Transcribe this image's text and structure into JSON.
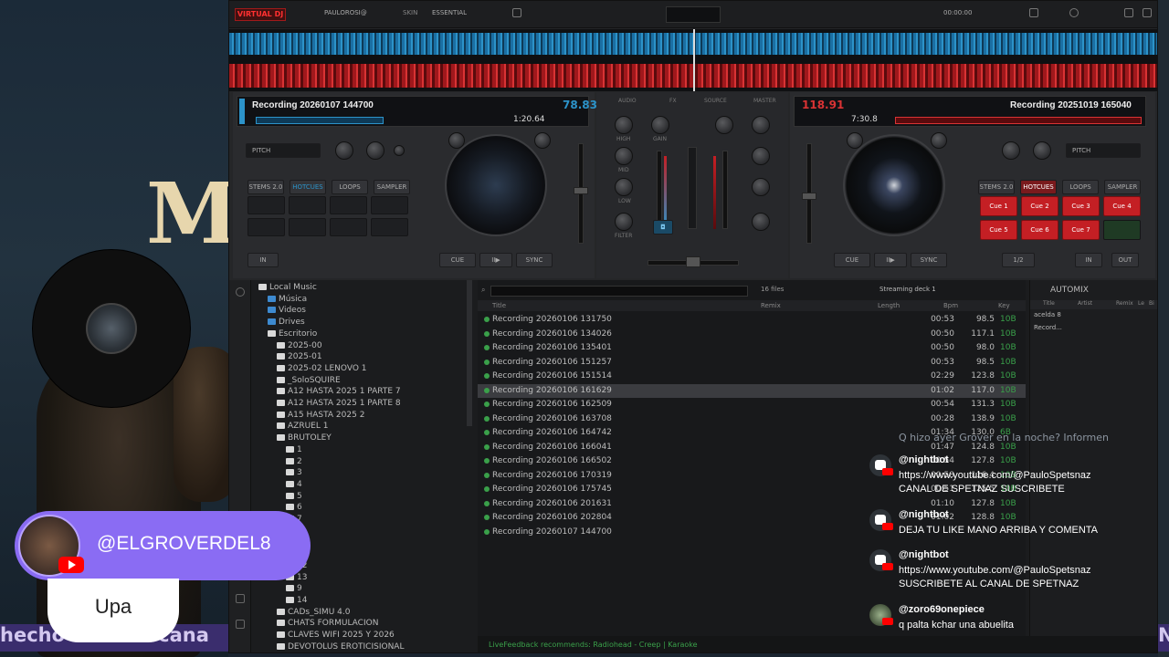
{
  "stream": {
    "bg_title": "M",
    "marquee_left": "hecho en este cana",
    "marquee_right": "N",
    "user_handle": "@ELGROVERDEL8",
    "user_message": "Upa"
  },
  "app": {
    "logo": "VIRTUAL DJ",
    "user": "PAULOROSI@",
    "skin_label": "SKIN",
    "skin_value": "ESSENTIAL",
    "clock": "00:00:00"
  },
  "deck_left": {
    "track": "Recording 20260107 144700",
    "bpm": "78.83",
    "elapsed": "1:20.64",
    "pitch_label": "PITCH",
    "tabs": [
      "STEMS 2.0",
      "HOTCUES",
      "LOOPS",
      "SAMPLER"
    ],
    "cue": "CUE",
    "play": "II▶",
    "sync": "SYNC",
    "in": "IN",
    "out": "OUT"
  },
  "deck_right": {
    "track": "Recording 20251019 165040",
    "bpm": "118.91",
    "elapsed": "7:30.8",
    "pitch_label": "PITCH",
    "tabs": [
      "STEMS 2.0",
      "HOTCUES",
      "LOOPS",
      "SAMPLER"
    ],
    "cues": [
      "Cue 1",
      "Cue 2",
      "Cue 3",
      "Cue 4",
      "Cue 5",
      "Cue 6",
      "Cue 7"
    ],
    "cue": "CUE",
    "play": "II▶",
    "sync": "SYNC",
    "loop": "1/2",
    "in": "IN",
    "out": "OUT"
  },
  "mixer": {
    "labels": [
      "AUDIO",
      "FX",
      "SOURCE",
      "MASTER"
    ],
    "eq": [
      "HIGH",
      "MID",
      "LOW",
      "FILTER"
    ],
    "gain": "GAIN"
  },
  "browser": {
    "tree": [
      {
        "label": "Local Music",
        "indent": 0
      },
      {
        "label": "Música",
        "indent": 1
      },
      {
        "label": "Videos",
        "indent": 1
      },
      {
        "label": "Drives",
        "indent": 1
      },
      {
        "label": "Escritorio",
        "indent": 1
      },
      {
        "label": "2025-00",
        "indent": 2
      },
      {
        "label": "2025-01",
        "indent": 2
      },
      {
        "label": "2025-02 LENOVO 1",
        "indent": 2
      },
      {
        "label": "_SoloSQUIRE",
        "indent": 2
      },
      {
        "label": "A12 HASTA 2025 1 PARTE 7",
        "indent": 2
      },
      {
        "label": "A12 HASTA 2025 1 PARTE 8",
        "indent": 2
      },
      {
        "label": "A15 HASTA 2025 2",
        "indent": 2
      },
      {
        "label": "AZRUEL 1",
        "indent": 2
      },
      {
        "label": "BRUTOLEY",
        "indent": 2
      },
      {
        "label": "1",
        "indent": 3
      },
      {
        "label": "2",
        "indent": 3
      },
      {
        "label": "3",
        "indent": 3
      },
      {
        "label": "4",
        "indent": 3
      },
      {
        "label": "5",
        "indent": 3
      },
      {
        "label": "6",
        "indent": 3
      },
      {
        "label": "7",
        "indent": 3
      },
      {
        "label": "8",
        "indent": 3
      },
      {
        "label": "10",
        "indent": 3
      },
      {
        "label": "11",
        "indent": 3
      },
      {
        "label": "12",
        "indent": 3
      },
      {
        "label": "13",
        "indent": 3
      },
      {
        "label": "9",
        "indent": 3
      },
      {
        "label": "14",
        "indent": 3
      },
      {
        "label": "CADs_SIMU 4.0",
        "indent": 2
      },
      {
        "label": "CHATS FORMULACION",
        "indent": 2
      },
      {
        "label": "CLAVES WIFI 2025 Y 2026",
        "indent": 2
      },
      {
        "label": "DEVOTOLUS EROTICISIONAL",
        "indent": 2
      }
    ],
    "file_count": "16 files",
    "streaming": "Streaming deck 1",
    "columns": {
      "title": "Title",
      "remix": "Remix",
      "length": "Length",
      "bpm": "Bpm",
      "key": "Key"
    },
    "files": [
      {
        "title": "Recording 20260106 131750",
        "length": "00:53",
        "bpm": "98.5",
        "key": "10B"
      },
      {
        "title": "Recording 20260106 134026",
        "length": "00:50",
        "bpm": "117.1",
        "key": "10B"
      },
      {
        "title": "Recording 20260106 135401",
        "length": "00:50",
        "bpm": "98.0",
        "key": "10B"
      },
      {
        "title": "Recording 20260106 151257",
        "length": "00:53",
        "bpm": "98.5",
        "key": "10B"
      },
      {
        "title": "Recording 20260106 151514",
        "length": "02:29",
        "bpm": "123.8",
        "key": "10B"
      },
      {
        "title": "Recording 20260106 161629",
        "length": "01:02",
        "bpm": "117.0",
        "key": "10B"
      },
      {
        "title": "Recording 20260106 162509",
        "length": "00:54",
        "bpm": "131.3",
        "key": "10B"
      },
      {
        "title": "Recording 20260106 163708",
        "length": "00:28",
        "bpm": "138.9",
        "key": "10B"
      },
      {
        "title": "Recording 20260106 164742",
        "length": "01:34",
        "bpm": "130.0",
        "key": "6B"
      },
      {
        "title": "Recording 20260106 166041",
        "length": "01:47",
        "bpm": "124.8",
        "key": "10B"
      },
      {
        "title": "Recording 20260106 166502",
        "length": "00:54",
        "bpm": "127.8",
        "key": "10B"
      },
      {
        "title": "Recording 20260106 170319",
        "length": "00:58",
        "bpm": "116.4",
        "key": "10B"
      },
      {
        "title": "Recording 20260106 175745",
        "length": "00:51",
        "bpm": "125.5",
        "key": "10B"
      },
      {
        "title": "Recording 20260106 201631",
        "length": "01:10",
        "bpm": "127.8",
        "key": "10B"
      },
      {
        "title": "Recording 20260106 202804",
        "length": "01:02",
        "bpm": "128.8",
        "key": "10B"
      },
      {
        "title": "Recording 20260107 144700",
        "length": "",
        "bpm": "",
        "key": ""
      }
    ],
    "selected_index": 5,
    "automix": {
      "label": "AUTOMIX",
      "cols": [
        "Title",
        "Artist",
        "Remix",
        "Le",
        "Bi"
      ],
      "rows": [
        "acelda 8",
        "Record..."
      ]
    },
    "bottom_text": "LiveFeedback recommends: Radiohead - Creep | Karaoke"
  },
  "chat": {
    "faded": "Q hizo ayer Grover en la noche? Informen",
    "messages": [
      {
        "user": "@nightbot",
        "lines": [
          "https://www.youtube.com/@PauloSpetsnaz",
          "CANAL DE SPETNAZ SUSCRIBETE"
        ],
        "avatar": "robot"
      },
      {
        "user": "@nightbot",
        "lines": [
          "DEJA TU LIKE MANO ARRIBA Y COMENTA"
        ],
        "avatar": "robot"
      },
      {
        "user": "@nightbot",
        "lines": [
          "https://www.youtube.com/@PauloSpetsnaz",
          "SUSCRIBETE AL CANAL DE SPETNAZ"
        ],
        "avatar": "robot"
      },
      {
        "user": "@zoro69onepiece",
        "lines": [
          "q palta kchar una abuelita"
        ],
        "avatar": "photo"
      }
    ]
  },
  "colors": {
    "accent_red": "#c41f24",
    "accent_blue": "#2c93c9",
    "pill": "#8a6cf3",
    "key_green": "#3aa04a"
  }
}
